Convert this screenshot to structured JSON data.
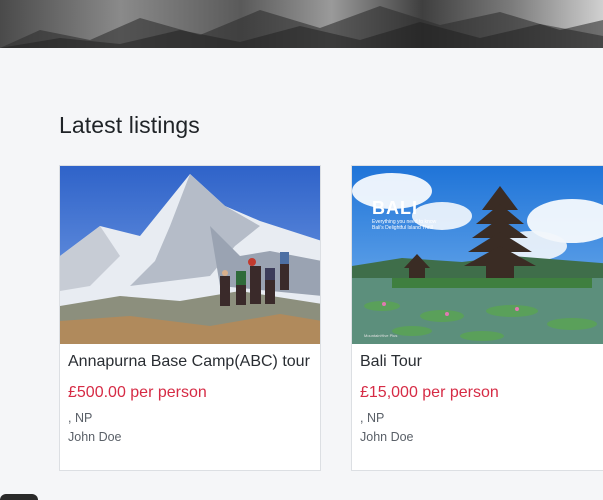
{
  "section": {
    "title": "Latest listings"
  },
  "listings": [
    {
      "title": "Annapurna Base Camp(ABC) tour",
      "price": "£500.00 per person",
      "location": ", NP",
      "author": "John Doe",
      "image": "mountain-trekkers-photo"
    },
    {
      "title": "Bali Tour",
      "price": "£15,000 per person",
      "location": ", NP",
      "author": "John Doe",
      "image": "bali-temple-photo",
      "image_text": {
        "heading": "BALI",
        "line1": "Everything you need to know",
        "line2": "Bali's Delightful Island Thrill",
        "watermark": "MountainHive Plus"
      }
    }
  ],
  "colors": {
    "price": "#d62b45",
    "background": "#f5f6f8",
    "card_border": "#dcdfe3"
  }
}
